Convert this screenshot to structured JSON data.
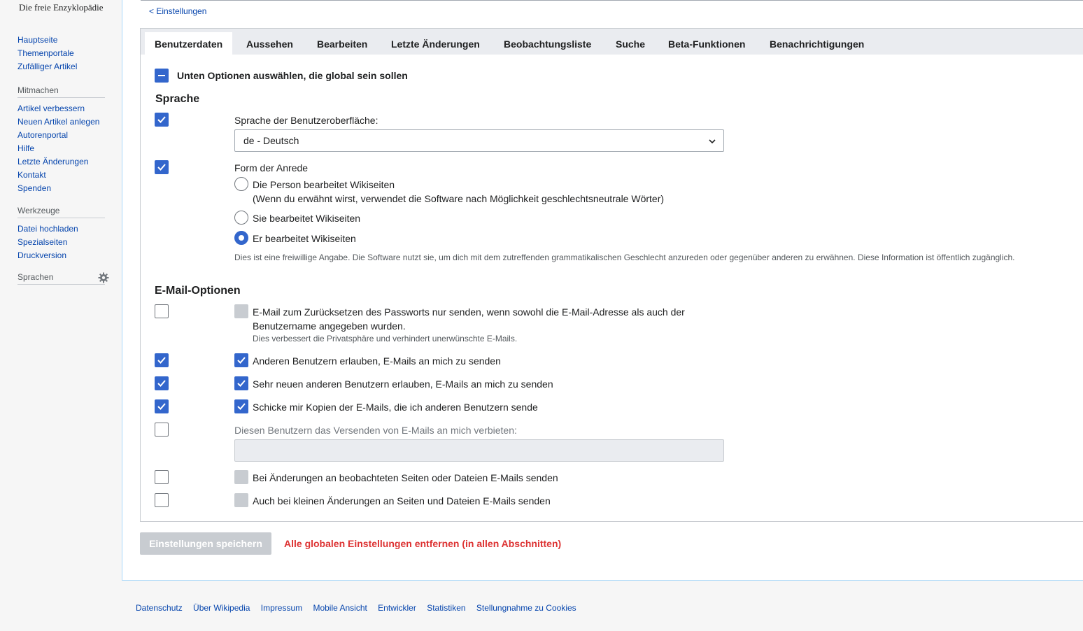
{
  "sidebar": {
    "tagline": "Die freie Enzyklopädie",
    "nav": [
      "Hauptseite",
      "Themenportale",
      "Zufälliger Artikel"
    ],
    "mitmachen_heading": "Mitmachen",
    "mitmachen": [
      "Artikel verbessern",
      "Neuen Artikel anlegen",
      "Autorenportal",
      "Hilfe",
      "Letzte Änderungen",
      "Kontakt",
      "Spenden"
    ],
    "werkzeuge_heading": "Werkzeuge",
    "werkzeuge": [
      "Datei hochladen",
      "Spezialseiten",
      "Druckversion"
    ],
    "sprachen_heading": "Sprachen",
    "gear_icon": "gear-icon"
  },
  "breadcrumb": "< Einstellungen",
  "tabs": [
    "Benutzerdaten",
    "Aussehen",
    "Bearbeiten",
    "Letzte Änderungen",
    "Beobachtungsliste",
    "Suche",
    "Beta-Funktionen",
    "Benachrichtigungen"
  ],
  "global_toggle_label": "Unten Optionen auswählen, die global sein sollen",
  "sprache": {
    "heading": "Sprache",
    "ui_language_label": "Sprache der Benutzeroberfläche:",
    "ui_language_value": "de - Deutsch",
    "gender_label": "Form der Anrede",
    "gender_options": [
      {
        "label": "Die Person bearbeitet Wikiseiten",
        "sub": "(Wenn du erwähnt wirst, verwendet die Software nach Möglichkeit geschlechtsneutrale Wörter)"
      },
      {
        "label": "Sie bearbeitet Wikiseiten"
      },
      {
        "label": "Er bearbeitet Wikiseiten"
      }
    ],
    "gender_help": "Dies ist eine freiwillige Angabe. Die Software nutzt sie, um dich mit dem zutreffenden grammatikalischen Geschlecht anzureden oder gegenüber anderen zu erwähnen. Diese Information ist öffentlich zugänglich."
  },
  "email": {
    "heading": "E-Mail-Optionen",
    "reset_line1": "E-Mail zum Zurücksetzen des Passworts nur senden, wenn sowohl die E-Mail-Adresse als auch der",
    "reset_line2": "Benutzername angegeben wurden.",
    "reset_help": "Dies verbessert die Privatsphäre und verhindert unerwünschte E-Mails.",
    "allow_others": "Anderen Benutzern erlauben, E-Mails an mich zu senden",
    "allow_new": "Sehr neuen anderen Benutzern erlauben, E-Mails an mich zu senden",
    "send_copies": "Schicke mir Kopien der E-Mails, die ich anderen Benutzern sende",
    "blocklist_label": "Diesen Benutzern das Versenden von E-Mails an mich verbieten:",
    "watchlist_mail": "Bei Änderungen an beobachteten Seiten oder Dateien E-Mails senden",
    "minor_mail": "Auch bei kleinen Änderungen an Seiten und Dateien E-Mails senden"
  },
  "actions": {
    "save": "Einstellungen speichern",
    "reset_global": "Alle globalen Einstellungen entfernen (in allen Abschnitten)"
  },
  "footer": [
    "Datenschutz",
    "Über Wikipedia",
    "Impressum",
    "Mobile Ansicht",
    "Entwickler",
    "Statistiken",
    "Stellungnahme zu Cookies"
  ],
  "colors": {
    "accent": "#3366cc",
    "link": "#0645ad",
    "destructive": "#d33333"
  }
}
